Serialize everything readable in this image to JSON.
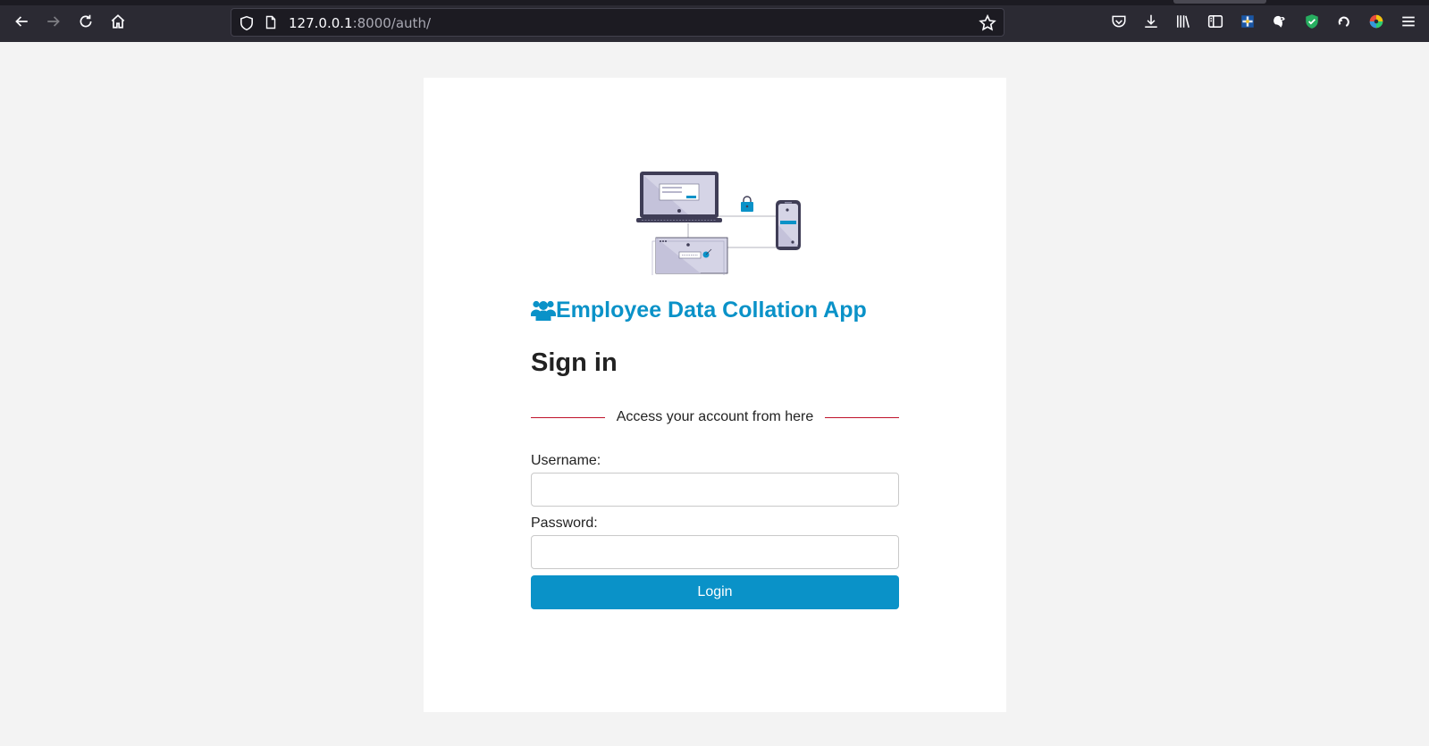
{
  "browser": {
    "url_host": "127.0.0.1",
    "url_rest": ":8000/auth/"
  },
  "app": {
    "title": "Employee Data Collation App"
  },
  "form": {
    "heading": "Sign in",
    "divider_text": "Access your account from here",
    "username_label": "Username:",
    "username_value": "",
    "password_label": "Password:",
    "password_value": "",
    "login_label": "Login"
  },
  "colors": {
    "accent": "#0a92c8",
    "divider": "#c0132b",
    "page_bg": "#f3f3f3",
    "card_bg": "#ffffff",
    "browser_toolbar": "#2b2a33"
  },
  "icons": {
    "back": "back-arrow-icon",
    "forward": "forward-arrow-icon",
    "reload": "reload-icon",
    "home": "home-icon",
    "tracking": "shield-icon",
    "page": "page-icon",
    "bookmark": "star-icon",
    "pocket": "pocket-icon",
    "downloads": "download-icon",
    "library": "library-icon",
    "sidebar": "sidebar-icon",
    "menu": "hamburger-menu-icon",
    "brand": "users-icon"
  }
}
